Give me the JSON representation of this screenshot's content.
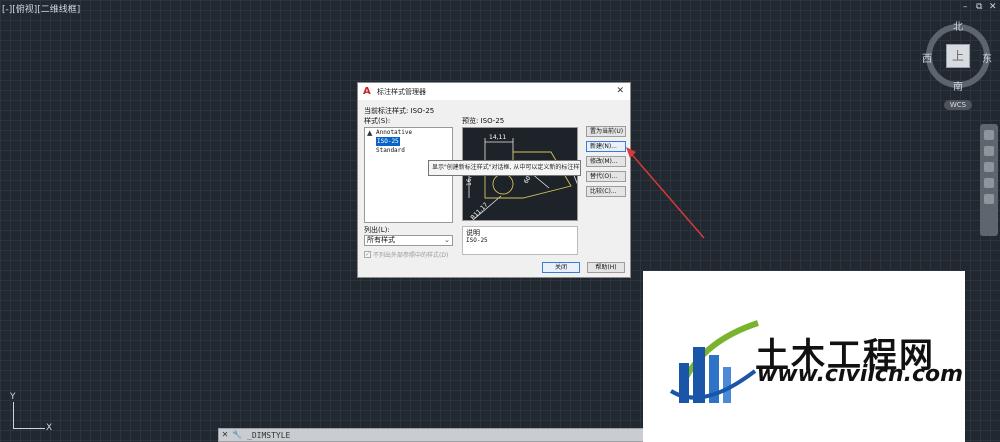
{
  "viewport": {
    "label": "[-][俯视][二维线框]"
  },
  "window_controls": {
    "minimize": "–",
    "restore": "⧉",
    "close": "✕"
  },
  "viewcube": {
    "north": "北",
    "south": "南",
    "east": "东",
    "west": "西",
    "top": "上",
    "wcs": "WCS"
  },
  "ucs": {
    "y": "Y",
    "x": "X"
  },
  "command_line": {
    "close": "✕",
    "customize": "🔧",
    "prompt": "_DIMSTYLE",
    "arrow": "▲"
  },
  "dialog": {
    "title": "标注样式管理器",
    "close": "✕",
    "current_style_label": "当前标注样式: ISO-25",
    "styles_label": "样式(S):",
    "styles": [
      "Annotative",
      "ISO-25",
      "Standard"
    ],
    "selected_style": "ISO-25",
    "list_label": "列出(L):",
    "list_value": "所有样式",
    "checkbox_label": "不列出外部参照中的样式(D)",
    "preview_label": "预览: ISO-25",
    "preview_dims": {
      "top": "14,11",
      "left": "16,6",
      "angle": "60°",
      "diag": "R11,17"
    },
    "description_label": "说明",
    "description_value": "ISO-25",
    "buttons": {
      "set_current": "置为当前(U)",
      "new": "新建(N)...",
      "modify": "修改(M)...",
      "override": "替代(O)...",
      "compare": "比较(C)...",
      "close": "关闭",
      "help": "帮助(H)"
    },
    "tooltip": "显示\"创建新标注样式\"对话框, 从中可以定义新的标注样式。"
  },
  "watermark": {
    "name": "土木工程网",
    "url": "www.civilcn.com"
  },
  "colors": {
    "background": "#212830",
    "accent": "#0a64c8",
    "arrow": "#d63a3a",
    "logo_blue": "#1a55a8",
    "logo_green": "#7ab32e"
  }
}
